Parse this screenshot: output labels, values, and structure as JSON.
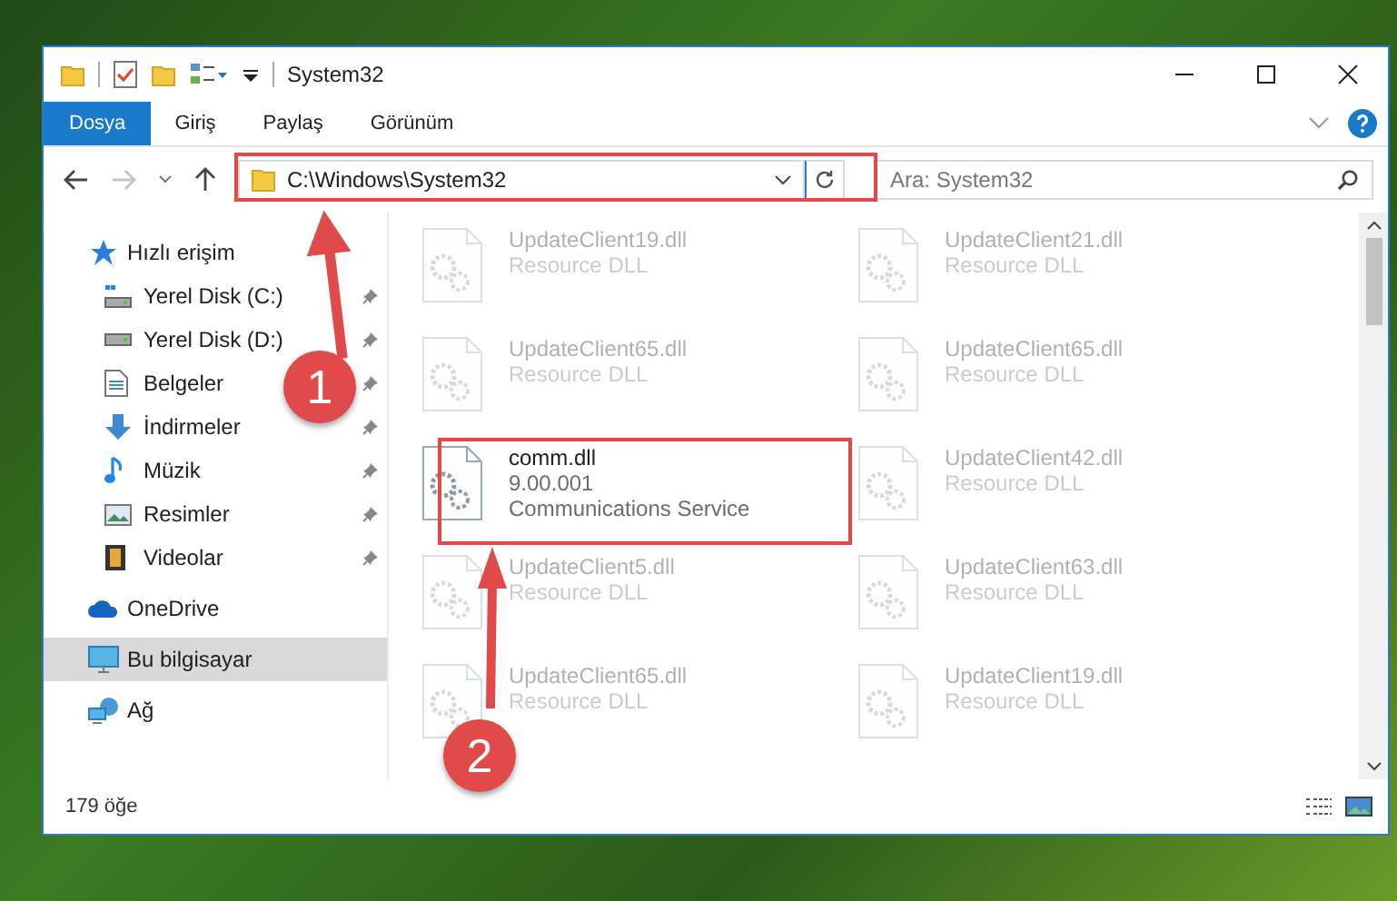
{
  "window": {
    "title": "System32"
  },
  "ribbon_tabs": [
    {
      "label": "Dosya",
      "selected": true
    },
    {
      "label": "Giriş",
      "selected": false
    },
    {
      "label": "Paylaş",
      "selected": false
    },
    {
      "label": "Görünüm",
      "selected": false
    }
  ],
  "navigation": {
    "forward_disabled": true
  },
  "address_bar": {
    "value": "C:\\Windows\\System32"
  },
  "search": {
    "placeholder": "Ara: System32"
  },
  "sidebar": {
    "items": [
      {
        "label": "Hızlı erişim",
        "kind": "star",
        "selected": false,
        "children": [
          {
            "label": "Yerel Disk (C:)",
            "kind": "drive-c",
            "pinned": true,
            "selected": false
          },
          {
            "label": "Yerel Disk (D:)",
            "kind": "drive",
            "pinned": true,
            "selected": false
          },
          {
            "label": "Belgeler",
            "kind": "docs",
            "pinned": true,
            "selected": false
          },
          {
            "label": "İndirmeler",
            "kind": "download",
            "pinned": true,
            "selected": false
          },
          {
            "label": "Müzik",
            "kind": "music",
            "pinned": true,
            "selected": false
          },
          {
            "label": "Resimler",
            "kind": "pictures",
            "pinned": true,
            "selected": false
          },
          {
            "label": "Videolar",
            "kind": "videos",
            "pinned": true,
            "selected": false
          }
        ]
      },
      {
        "label": "OneDrive",
        "kind": "cloud",
        "selected": false
      },
      {
        "label": "Bu bilgisayar",
        "kind": "computer",
        "selected": true
      },
      {
        "label": "Ağ",
        "kind": "network",
        "selected": false
      }
    ]
  },
  "files": [
    {
      "name": "UpdateClient19.dll",
      "details": [
        "Resource DLL"
      ],
      "dimmed": true
    },
    {
      "name": "UpdateClient21.dll",
      "details": [
        "Resource DLL"
      ],
      "dimmed": true
    },
    {
      "name": "UpdateClient65.dll",
      "details": [
        "Resource DLL"
      ],
      "dimmed": true
    },
    {
      "name": "UpdateClient65.dll",
      "details": [
        "Resource DLL"
      ],
      "dimmed": true
    },
    {
      "name": "comm.dll",
      "details": [
        "9.00.001",
        "Communications Service"
      ],
      "dimmed": false
    },
    {
      "name": "UpdateClient42.dll",
      "details": [
        "Resource DLL"
      ],
      "dimmed": true
    },
    {
      "name": "UpdateClient5.dll",
      "details": [
        "Resource DLL"
      ],
      "dimmed": true
    },
    {
      "name": "UpdateClient63.dll",
      "details": [
        "Resource DLL"
      ],
      "dimmed": true
    },
    {
      "name": "UpdateClient65.dll",
      "details": [
        "Resource DLL"
      ],
      "dimmed": true
    },
    {
      "name": "UpdateClient19.dll",
      "details": [
        "Resource DLL"
      ],
      "dimmed": true
    }
  ],
  "status_bar": {
    "item_count": "179 öğe"
  },
  "annotations": [
    {
      "label": "1"
    },
    {
      "label": "2"
    }
  ]
}
